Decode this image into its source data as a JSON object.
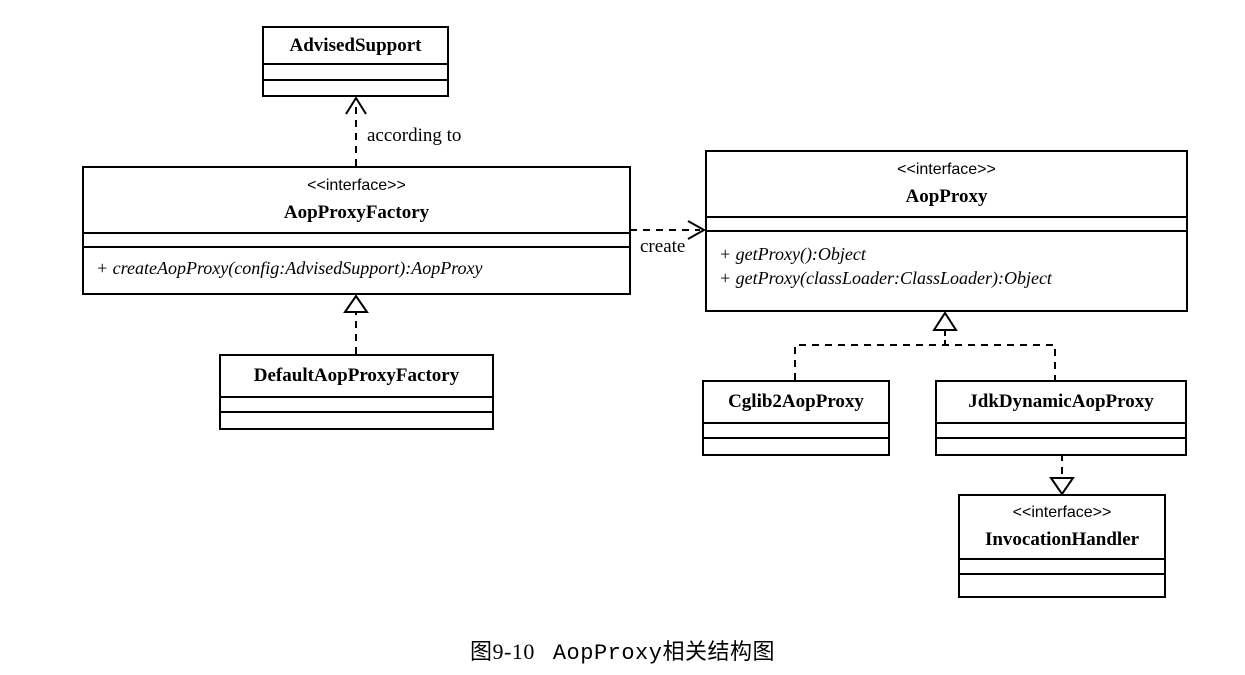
{
  "classes": {
    "advised_support": {
      "name": "AdvisedSupport"
    },
    "aop_proxy_factory": {
      "stereotype": "<<interface>>",
      "name": "AopProxyFactory",
      "operations": [
        "+ createAopProxy(config:AdvisedSupport):AopProxy"
      ]
    },
    "default_aop_proxy_factory": {
      "name": "DefaultAopProxyFactory"
    },
    "aop_proxy": {
      "stereotype": "<<interface>>",
      "name": "AopProxy",
      "operations": [
        "+ getProxy():Object",
        "+ getProxy(classLoader:ClassLoader):Object"
      ]
    },
    "cglib2_aop_proxy": {
      "name": "Cglib2AopProxy"
    },
    "jdk_dynamic_aop_proxy": {
      "name": "JdkDynamicAopProxy"
    },
    "invocation_handler": {
      "stereotype": "<<interface>>",
      "name": "InvocationHandler"
    }
  },
  "relations": {
    "according_to": "according to",
    "create": "create"
  },
  "caption": {
    "number": "图9-10",
    "code": "AopProxy",
    "text": "相关结构图"
  }
}
